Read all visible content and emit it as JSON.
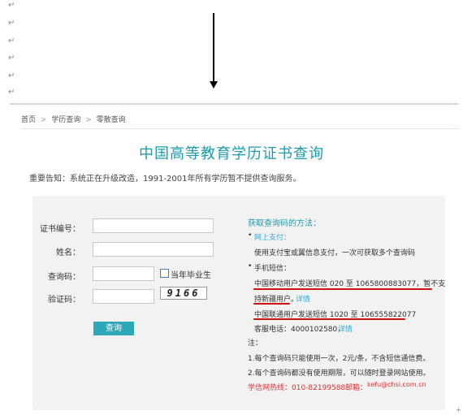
{
  "doc": {
    "paragraph_mark": "↵"
  },
  "breadcrumb": {
    "home": "首页",
    "sep": ">",
    "level2": "学历查询",
    "level3": "零散查询"
  },
  "title": "中国高等教育学历证书查询",
  "notice": "重要告知：系统正在升级改造，1991-2001年所有学历暂不提供查询服务。",
  "form": {
    "cert_no_label": "证书编号：",
    "name_label": "姓名：",
    "query_code_label": "查询码：",
    "captcha_label": "验证码：",
    "graduate_checkbox_label": "当年毕业生",
    "captcha_value": "9166",
    "submit_label": "查询"
  },
  "right": {
    "heading": "获取查询码的方法：",
    "online_bullet": "•",
    "online_label": "网上支付：",
    "online_desc": "使用支付宝或翼信息支付，一次可获取多个查询码",
    "sms_bullet": "•",
    "sms_label": "手机短信：",
    "mobile_line1": "中国移动用户发送短信 020 至 1065800883077，暂不支",
    "mobile_line2": "持新疆用户。",
    "mobile_detail": "详情",
    "unicom_line": "中国联通用户发送短信 1020 至 106555822077",
    "hotline_prefix": "客服电话：4000102580，",
    "hotline_detail": "详情",
    "note_label": "注：",
    "note1": "1.每个查询码只能使用一次，2元/条，不含短信通信费。",
    "note2": "2.每个查询码都没有使用期限，可以随时登录网站使用。",
    "footer_hotline": "学信网热线：010-82199588",
    "footer_email_label": "邮箱：",
    "footer_email": "kefu@chsi.com.cn"
  },
  "colors": {
    "teal": "#1c9bb0",
    "button": "#2ea7b8",
    "link": "#3aa7d6",
    "red": "#e03030"
  }
}
